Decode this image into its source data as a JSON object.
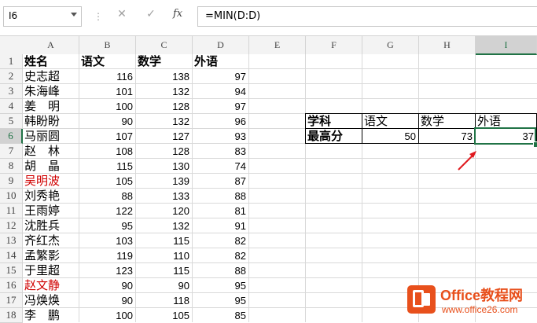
{
  "formula_bar": {
    "name_box": "I6",
    "formula": "=MIN(D:D)",
    "cancel_icon": "x-icon",
    "enter_icon": "check-icon",
    "fx_label": "fx"
  },
  "columns": [
    "A",
    "B",
    "C",
    "D",
    "E",
    "F",
    "G",
    "H",
    "I"
  ],
  "selected_column": "I",
  "selected_row": "6",
  "rows": [
    "1",
    "2",
    "3",
    "4",
    "5",
    "6",
    "7",
    "8",
    "9",
    "10",
    "11",
    "12",
    "13",
    "14",
    "15",
    "16",
    "17",
    "18"
  ],
  "headers": {
    "name": "姓名",
    "chinese": "语文",
    "math": "数学",
    "foreign": "外语"
  },
  "students": [
    {
      "name": "史志超",
      "chinese": "116",
      "math": "138",
      "foreign": "97"
    },
    {
      "name": "朱海峰",
      "chinese": "101",
      "math": "132",
      "foreign": "94"
    },
    {
      "name": "姜　明",
      "chinese": "100",
      "math": "128",
      "foreign": "97"
    },
    {
      "name": "韩盼盼",
      "chinese": "90",
      "math": "132",
      "foreign": "96"
    },
    {
      "name": "马丽圆",
      "chinese": "107",
      "math": "127",
      "foreign": "93"
    },
    {
      "name": "赵　林",
      "chinese": "108",
      "math": "128",
      "foreign": "83"
    },
    {
      "name": "胡　晶",
      "chinese": "115",
      "math": "130",
      "foreign": "74"
    },
    {
      "name": "吴明波",
      "chinese": "105",
      "math": "139",
      "foreign": "87",
      "red": true
    },
    {
      "name": "刘秀艳",
      "chinese": "88",
      "math": "133",
      "foreign": "88"
    },
    {
      "name": "王雨婷",
      "chinese": "122",
      "math": "120",
      "foreign": "81"
    },
    {
      "name": "沈胜兵",
      "chinese": "95",
      "math": "132",
      "foreign": "91"
    },
    {
      "name": "齐红杰",
      "chinese": "103",
      "math": "115",
      "foreign": "82"
    },
    {
      "name": "孟繁影",
      "chinese": "119",
      "math": "110",
      "foreign": "82"
    },
    {
      "name": "于里超",
      "chinese": "123",
      "math": "115",
      "foreign": "88"
    },
    {
      "name": "赵文静",
      "chinese": "90",
      "math": "90",
      "foreign": "95",
      "red": true
    },
    {
      "name": "冯焕焕",
      "chinese": "90",
      "math": "118",
      "foreign": "95"
    },
    {
      "name": "李　鹏",
      "chinese": "100",
      "math": "105",
      "foreign": "85"
    }
  ],
  "summary": {
    "subject_label": "学科",
    "max_label": "最高分",
    "subjects": [
      "语文",
      "数学",
      "外语"
    ],
    "values": [
      "50",
      "73",
      "37"
    ]
  },
  "watermark": {
    "title": "Office教程网",
    "url": "www.office26.com"
  },
  "colors": {
    "accent": "#217346",
    "red_text": "#d00000",
    "arrow": "#e0191e",
    "brand": "#e8501c"
  }
}
